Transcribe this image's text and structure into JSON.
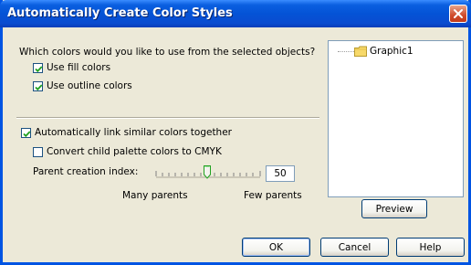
{
  "window": {
    "title": "Automatically Create Color Styles"
  },
  "question": "Which colors would you like to use from the selected objects?",
  "options": {
    "use_fill": {
      "label": "Use fill colors",
      "checked": true
    },
    "use_outline": {
      "label": "Use outline colors",
      "checked": true
    },
    "auto_link": {
      "label": "Automatically link similar colors together",
      "checked": true
    },
    "convert_cmyk": {
      "label": "Convert child palette colors to CMYK",
      "checked": false
    }
  },
  "parent_index": {
    "label": "Parent creation index:",
    "value": "50",
    "slider_level": 0.5,
    "min_label": "Many parents",
    "max_label": "Few parents"
  },
  "tree": {
    "items": [
      {
        "label": "Graphic1"
      }
    ]
  },
  "buttons": {
    "preview": "Preview",
    "ok": "OK",
    "cancel": "Cancel",
    "help": "Help"
  },
  "colors": {
    "title_bar": "#0453D6",
    "dialog_bg": "#ECE9D8",
    "check": "#21A121",
    "close": "#D04B2B"
  }
}
